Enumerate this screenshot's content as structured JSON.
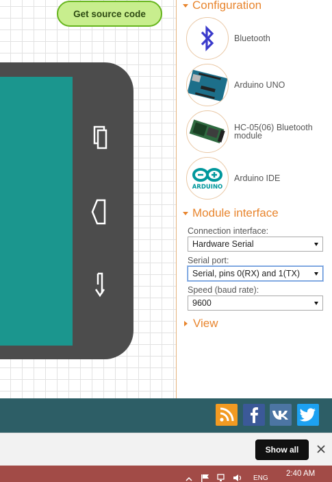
{
  "workspace": {
    "get_source_label": "Get source code"
  },
  "configuration": {
    "title": "Configuration",
    "items": [
      {
        "label": "Bluetooth",
        "icon": "bluetooth-icon"
      },
      {
        "label": "Arduino UNO",
        "icon": "arduino-uno-board-icon"
      },
      {
        "label": "HC-05(06) Bluetooth module",
        "icon": "hc05-module-icon"
      },
      {
        "label": "Arduino IDE",
        "icon": "arduino-ide-logo-icon",
        "logo_text": "ARDUINO"
      }
    ]
  },
  "module_interface": {
    "title": "Module interface",
    "connection_label": "Connection interface:",
    "connection_value": "Hardware Serial",
    "serial_label": "Serial port:",
    "serial_value": "Serial, pins 0(RX) and 1(TX)",
    "speed_label": "Speed (baud rate):",
    "speed_value": "9600"
  },
  "view": {
    "title": "View"
  },
  "footer": {
    "social": [
      {
        "name": "rss",
        "color": "#f29a22"
      },
      {
        "name": "facebook",
        "color": "#3b5998"
      },
      {
        "name": "vk",
        "color": "#4c75a3"
      },
      {
        "name": "twitter",
        "color": "#1da1f2"
      }
    ],
    "background": "#2d5e66"
  },
  "download_bar": {
    "show_all_label": "Show all"
  },
  "taskbar": {
    "language": "ENG",
    "time": "2:40 AM",
    "background": "#a24b47"
  },
  "colors": {
    "accent_orange": "#e8852e",
    "phone_body": "#4c4c4c",
    "phone_screen": "#1b968e",
    "button_green": "#c8ee8e"
  }
}
